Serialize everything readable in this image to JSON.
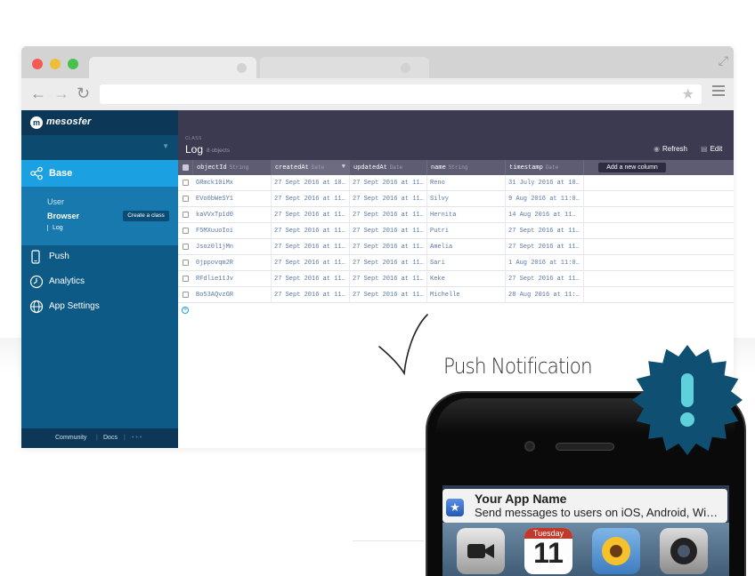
{
  "browser": {
    "url": "",
    "traffic_light_colors": [
      "#f25b55",
      "#f0bd37",
      "#48c04a"
    ],
    "back_icon": "arrow-left-icon",
    "forward_icon": "arrow-right-icon",
    "reload_icon": "reload-icon",
    "star_icon": "star-icon",
    "menu_icon": "hamburger-menu-icon"
  },
  "sidebar": {
    "brand": "mesosfer",
    "base": {
      "label": "Base",
      "icon": "share-icon"
    },
    "sub": {
      "user": "User",
      "browser": "Browser",
      "create_class": "Create a class",
      "log": "Log"
    },
    "items": [
      {
        "label": "Push",
        "icon": "phone-icon"
      },
      {
        "label": "Analytics",
        "icon": "clock-icon"
      },
      {
        "label": "App Settings",
        "icon": "globe-icon"
      }
    ],
    "footer": {
      "community": "Community",
      "docs": "Docs",
      "more": "• • •"
    }
  },
  "header": {
    "class_label": "CLASS",
    "title": "Log",
    "count": "8 objects",
    "refresh": "Refresh",
    "edit": "Edit"
  },
  "grid": {
    "columns": [
      {
        "name": "objectId",
        "type": "String"
      },
      {
        "name": "createdAt",
        "type": "Date"
      },
      {
        "name": "updatedAt",
        "type": "Date"
      },
      {
        "name": "name",
        "type": "String"
      },
      {
        "name": "timestamp",
        "type": "Date"
      }
    ],
    "add_column": "Add a new column",
    "rows": [
      [
        "GRmck10iMx",
        "27 Sept 2016 at 10…",
        "27 Sept 2016 at 11…",
        "Reno",
        "31 July 2016 at 10…"
      ],
      [
        "EVo0bWeSY1",
        "27 Sept 2016 at 11…",
        "27 Sept 2016 at 11…",
        "Silvy",
        "9 Aug 2016 at 11:0…"
      ],
      [
        "kaVVxTp1d0",
        "27 Sept 2016 at 11…",
        "27 Sept 2016 at 11…",
        "Hernita",
        "14 Aug 2016 at 11…"
      ],
      [
        "F5MXuuoIoi",
        "27 Sept 2016 at 11…",
        "27 Sept 2016 at 11…",
        "Putri",
        "27 Sept 2016 at 11…"
      ],
      [
        "Jsoz0l1jMn",
        "27 Sept 2016 at 11…",
        "27 Sept 2016 at 11…",
        "Amelia",
        "27 Sept 2016 at 11…"
      ],
      [
        "0jppovqm2R",
        "27 Sept 2016 at 11…",
        "27 Sept 2016 at 11…",
        "Sari",
        "1 Aug 2016 at 11:0…"
      ],
      [
        "RFdlie11Jv",
        "27 Sept 2016 at 11…",
        "27 Sept 2016 at 11…",
        "Keke",
        "27 Sept 2016 at 11…"
      ],
      [
        "Bo53AQvzGR",
        "27 Sept 2016 at 11…",
        "27 Sept 2016 at 11…",
        "Michelle",
        "28 Aug 2016 at 11:…"
      ]
    ],
    "add_row_icon": "plus-circle-icon"
  },
  "overlay": {
    "caption": "Push Notification",
    "alert_icon": "exclamation-icon",
    "notification": {
      "app_name": "Your App Name",
      "message": "Send messages to users on iOS, Android, Wi…",
      "app_icon": "star-icon"
    },
    "home_icons": {
      "calendar_month": "Tuesday",
      "calendar_day": "11",
      "others": [
        "facetime-icon",
        "photos-icon",
        "camera-icon"
      ]
    }
  },
  "colors": {
    "sidebar": "#0e5a87",
    "sidebar_active": "#1ba0e1",
    "header_bg": "#3b3a50",
    "grid_header": "#5d5c72",
    "cell_text": "#5877a8",
    "seal": "#0f4f72",
    "seal_mark": "#5fd1dc"
  }
}
